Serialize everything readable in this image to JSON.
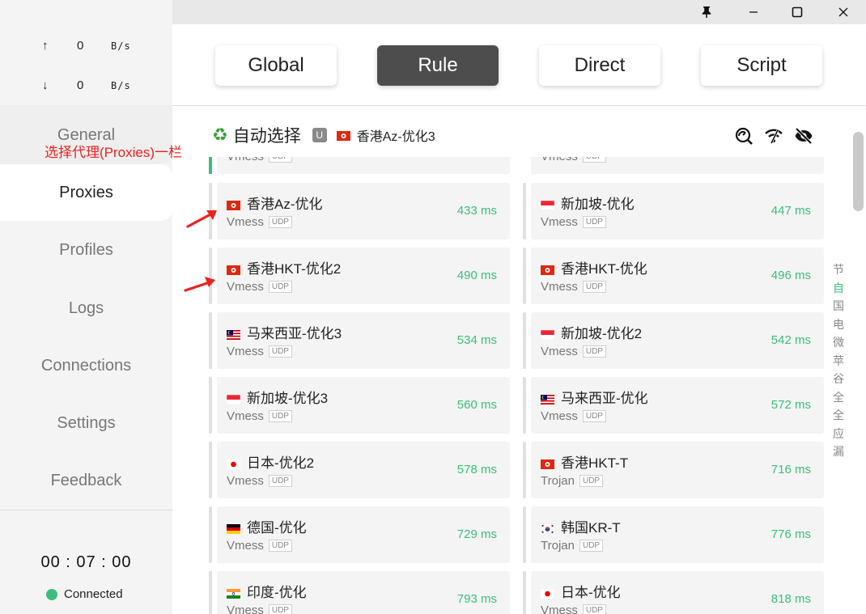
{
  "window": {
    "controls": [
      "pin-icon",
      "minimize-icon",
      "maximize-icon",
      "close-icon"
    ]
  },
  "traffic": {
    "upload": {
      "arrow": "↑",
      "value": "0",
      "unit": "B/s"
    },
    "download": {
      "arrow": "↓",
      "value": "0",
      "unit": "B/s"
    }
  },
  "sidebar": {
    "items": [
      {
        "label": "General"
      },
      {
        "label": "Proxies"
      },
      {
        "label": "Profiles"
      },
      {
        "label": "Logs"
      },
      {
        "label": "Connections"
      },
      {
        "label": "Settings"
      },
      {
        "label": "Feedback"
      }
    ],
    "active": "Proxies"
  },
  "annotation": {
    "text": "选择代理(Proxies)一栏",
    "color": "#e8231f"
  },
  "status": {
    "timer": "00 : 07 : 00",
    "connection": "Connected",
    "dot_color": "#3dbd7d"
  },
  "modes": [
    {
      "label": "Global"
    },
    {
      "label": "Rule"
    },
    {
      "label": "Direct"
    },
    {
      "label": "Script"
    }
  ],
  "active_mode": "Rule",
  "group": {
    "icon": "♻",
    "name": "自动选择",
    "badge": "U",
    "selected": "香港Az-优化3",
    "selected_flag": "hk",
    "actions": [
      "latency-test-icon",
      "wifi-icon",
      "hide-unavailable-icon"
    ]
  },
  "partial_row": [
    {
      "type": "Vmess",
      "udp": "UDP"
    },
    {
      "type": "Vmess",
      "udp": "UDP"
    }
  ],
  "proxies": [
    {
      "name": "香港Az-优化",
      "flag": "hk",
      "type": "Vmess",
      "udp": "UDP",
      "delay": "433 ms"
    },
    {
      "name": "新加坡-优化",
      "flag": "sg",
      "type": "Vmess",
      "udp": "UDP",
      "delay": "447 ms"
    },
    {
      "name": "香港HKT-优化2",
      "flag": "hk",
      "type": "Vmess",
      "udp": "UDP",
      "delay": "490 ms"
    },
    {
      "name": "香港HKT-优化",
      "flag": "hk",
      "type": "Vmess",
      "udp": "UDP",
      "delay": "496 ms"
    },
    {
      "name": "马来西亚-优化3",
      "flag": "my",
      "type": "Vmess",
      "udp": "UDP",
      "delay": "534 ms"
    },
    {
      "name": "新加坡-优化2",
      "flag": "sg",
      "type": "Vmess",
      "udp": "UDP",
      "delay": "542 ms"
    },
    {
      "name": "新加坡-优化3",
      "flag": "sg",
      "type": "Vmess",
      "udp": "UDP",
      "delay": "560 ms"
    },
    {
      "name": "马来西亚-优化",
      "flag": "my",
      "type": "Vmess",
      "udp": "UDP",
      "delay": "572 ms"
    },
    {
      "name": "日本-优化2",
      "flag": "jp",
      "type": "Vmess",
      "udp": "UDP",
      "delay": "578 ms"
    },
    {
      "name": "香港HKT-T",
      "flag": "hk",
      "type": "Trojan",
      "udp": "UDP",
      "delay": "716 ms"
    },
    {
      "name": "德国-优化",
      "flag": "de",
      "type": "Vmess",
      "udp": "UDP",
      "delay": "729 ms"
    },
    {
      "name": "韩国KR-T",
      "flag": "kr",
      "type": "Trojan",
      "udp": "UDP",
      "delay": "776 ms"
    },
    {
      "name": "印度-优化",
      "flag": "in",
      "type": "Vmess",
      "udp": "UDP",
      "delay": "793 ms"
    },
    {
      "name": "日本-优化",
      "flag": "jp",
      "type": "Vmess",
      "udp": "UDP",
      "delay": "818 ms"
    }
  ],
  "index_letters": [
    "节",
    "自",
    "国",
    "电",
    "微",
    "苹",
    "谷",
    "全",
    "全",
    "应",
    "漏"
  ],
  "index_active": "自",
  "colors": {
    "accent": "#3dbd7d",
    "active_mode_bg": "#4d4d4d",
    "annotation": "#e8231f"
  }
}
